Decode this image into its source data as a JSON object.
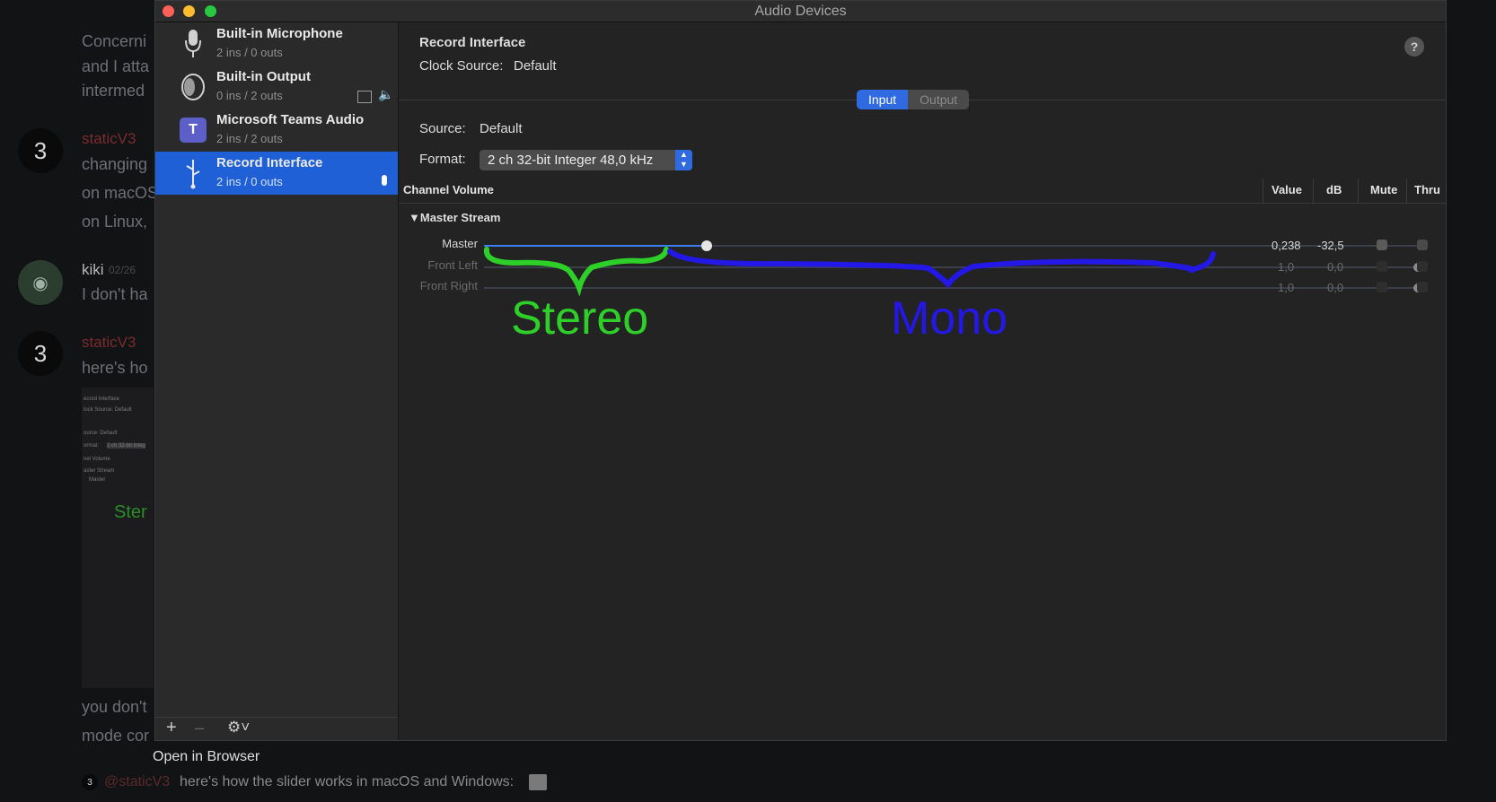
{
  "window": {
    "title": "Audio Devices"
  },
  "background": {
    "lines": [
      "Concerni",
      "and I atta",
      "intermed",
      "changing",
      "on macOS",
      "on Linux,",
      "I don't ha",
      "here's ho",
      "you don't",
      "mode cor"
    ],
    "user1": "staticV3",
    "user2": "kiki",
    "date2": "02/26",
    "user3": "staticV3",
    "open_in_browser": "Open in Browser",
    "reply_mention": "@staticV3",
    "reply_text": "here's how the slider works in macOS and Windows:",
    "thumb_lines": [
      "ecord Interface",
      "lock Source:  Default",
      "ource:  Default",
      "ormat:",
      "2 ch 32-bit integ",
      "nel Volume",
      "aster Stream",
      "Master",
      "Ster"
    ]
  },
  "devices": [
    {
      "name": "Built-in Microphone",
      "io": "2 ins / 0 outs",
      "icon": "microphone-icon"
    },
    {
      "name": "Built-in Output",
      "io": "0 ins / 2 outs",
      "icon": "speaker-icon"
    },
    {
      "name": "Microsoft Teams Audio",
      "io": "2 ins / 2 outs",
      "icon": "teams-icon"
    },
    {
      "name": "Record Interface",
      "io": "2 ins / 0 outs",
      "icon": "usb-icon",
      "selected": true
    }
  ],
  "detail": {
    "device_name": "Record Interface",
    "clock_label": "Clock Source:",
    "clock_value": "Default",
    "tab_input": "Input",
    "tab_output": "Output",
    "active_tab": "Input",
    "source_label": "Source:",
    "source_value": "Default",
    "format_label": "Format:",
    "format_value": "2 ch 32-bit Integer 48,0 kHz"
  },
  "table": {
    "col_channel": "Channel Volume",
    "col_value": "Value",
    "col_db": "dB",
    "col_mute": "Mute",
    "col_thru": "Thru",
    "group": "Master Stream",
    "rows": [
      {
        "name": "Master",
        "value": "0,238",
        "db": "-32,5",
        "level": 0.238
      },
      {
        "name": "Front Left",
        "value": "1,0",
        "db": "0,0",
        "level": 1.0
      },
      {
        "name": "Front Right",
        "value": "1,0",
        "db": "0,0",
        "level": 1.0
      }
    ]
  },
  "annotations": {
    "stereo": "Stereo",
    "mono": "Mono",
    "stereo_color": "#2fcf2a",
    "mono_color": "#2418e6"
  },
  "colors": {
    "accent": "#1f60d6",
    "close": "#fe5f57",
    "minimize": "#febc2e",
    "zoom": "#28c840"
  }
}
